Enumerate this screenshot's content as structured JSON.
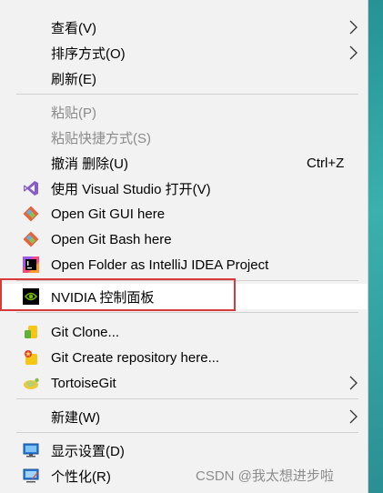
{
  "menu": {
    "view": "查看(V)",
    "sort": "排序方式(O)",
    "refresh": "刷新(E)",
    "paste": "粘贴(P)",
    "paste_shortcut": "粘贴快捷方式(S)",
    "undo_delete": "撤消 删除(U)",
    "undo_shortcut": "Ctrl+Z",
    "open_vs": "使用 Visual Studio 打开(V)",
    "git_gui": "Open Git GUI here",
    "git_bash": "Open Git Bash here",
    "open_idea": "Open Folder as IntelliJ IDEA Project",
    "nvidia": "NVIDIA 控制面板",
    "git_clone": "Git Clone...",
    "git_create": "Git Create repository here...",
    "tortoisegit": "TortoiseGit",
    "new": "新建(W)",
    "display": "显示设置(D)",
    "personalize": "个性化(R)"
  },
  "icons": {
    "visual_studio": "visual-studio-icon",
    "git": "git-icon",
    "intellij": "intellij-idea-icon",
    "nvidia": "nvidia-icon",
    "git_clone": "tortoisegit-clone-icon",
    "git_create": "tortoisegit-create-icon",
    "tortoisegit": "tortoisegit-icon",
    "display": "display-settings-icon",
    "personalize": "personalize-icon"
  },
  "colors": {
    "menu_bg": "#f2f2f2",
    "highlight_box": "#d83a3a",
    "disabled_text": "#8a8a8a"
  },
  "watermark": "CSDN @我太想进步啦"
}
